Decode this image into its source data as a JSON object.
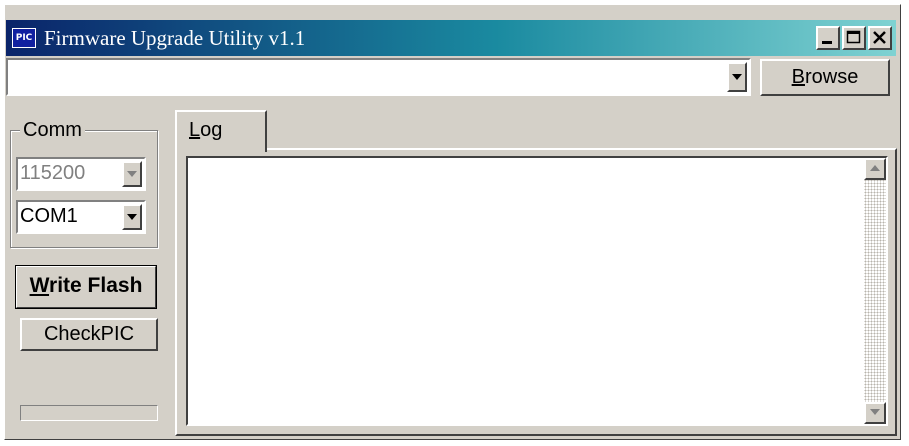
{
  "window": {
    "title": "Firmware Upgrade Utility v1.1",
    "icon_text": "PIC",
    "controls": [
      "minimize-icon",
      "maximize-icon",
      "close-icon"
    ]
  },
  "file_path": {
    "value": "",
    "browse_label": "Browse",
    "browse_mnemonic": "B",
    "browse_rest": "rowse"
  },
  "comm": {
    "group_label": "Comm",
    "baud_rate": "115200",
    "port": "COM1"
  },
  "actions": {
    "write_flash_label": "Write Flash",
    "write_flash_mnemonic": "W",
    "write_flash_rest": "rite Flash",
    "check_pic_label": "CheckPIC"
  },
  "progress": {
    "value": 0
  },
  "tabs": [
    {
      "label": "Log",
      "mnemonic": "L",
      "rest": "og",
      "active": true
    }
  ],
  "log": {
    "text": ""
  },
  "colors": {
    "title_gradient_start": "#0a246a",
    "title_gradient_end": "#7fd2d2",
    "face": "#d4d0c8",
    "disabled_text": "#808080"
  }
}
